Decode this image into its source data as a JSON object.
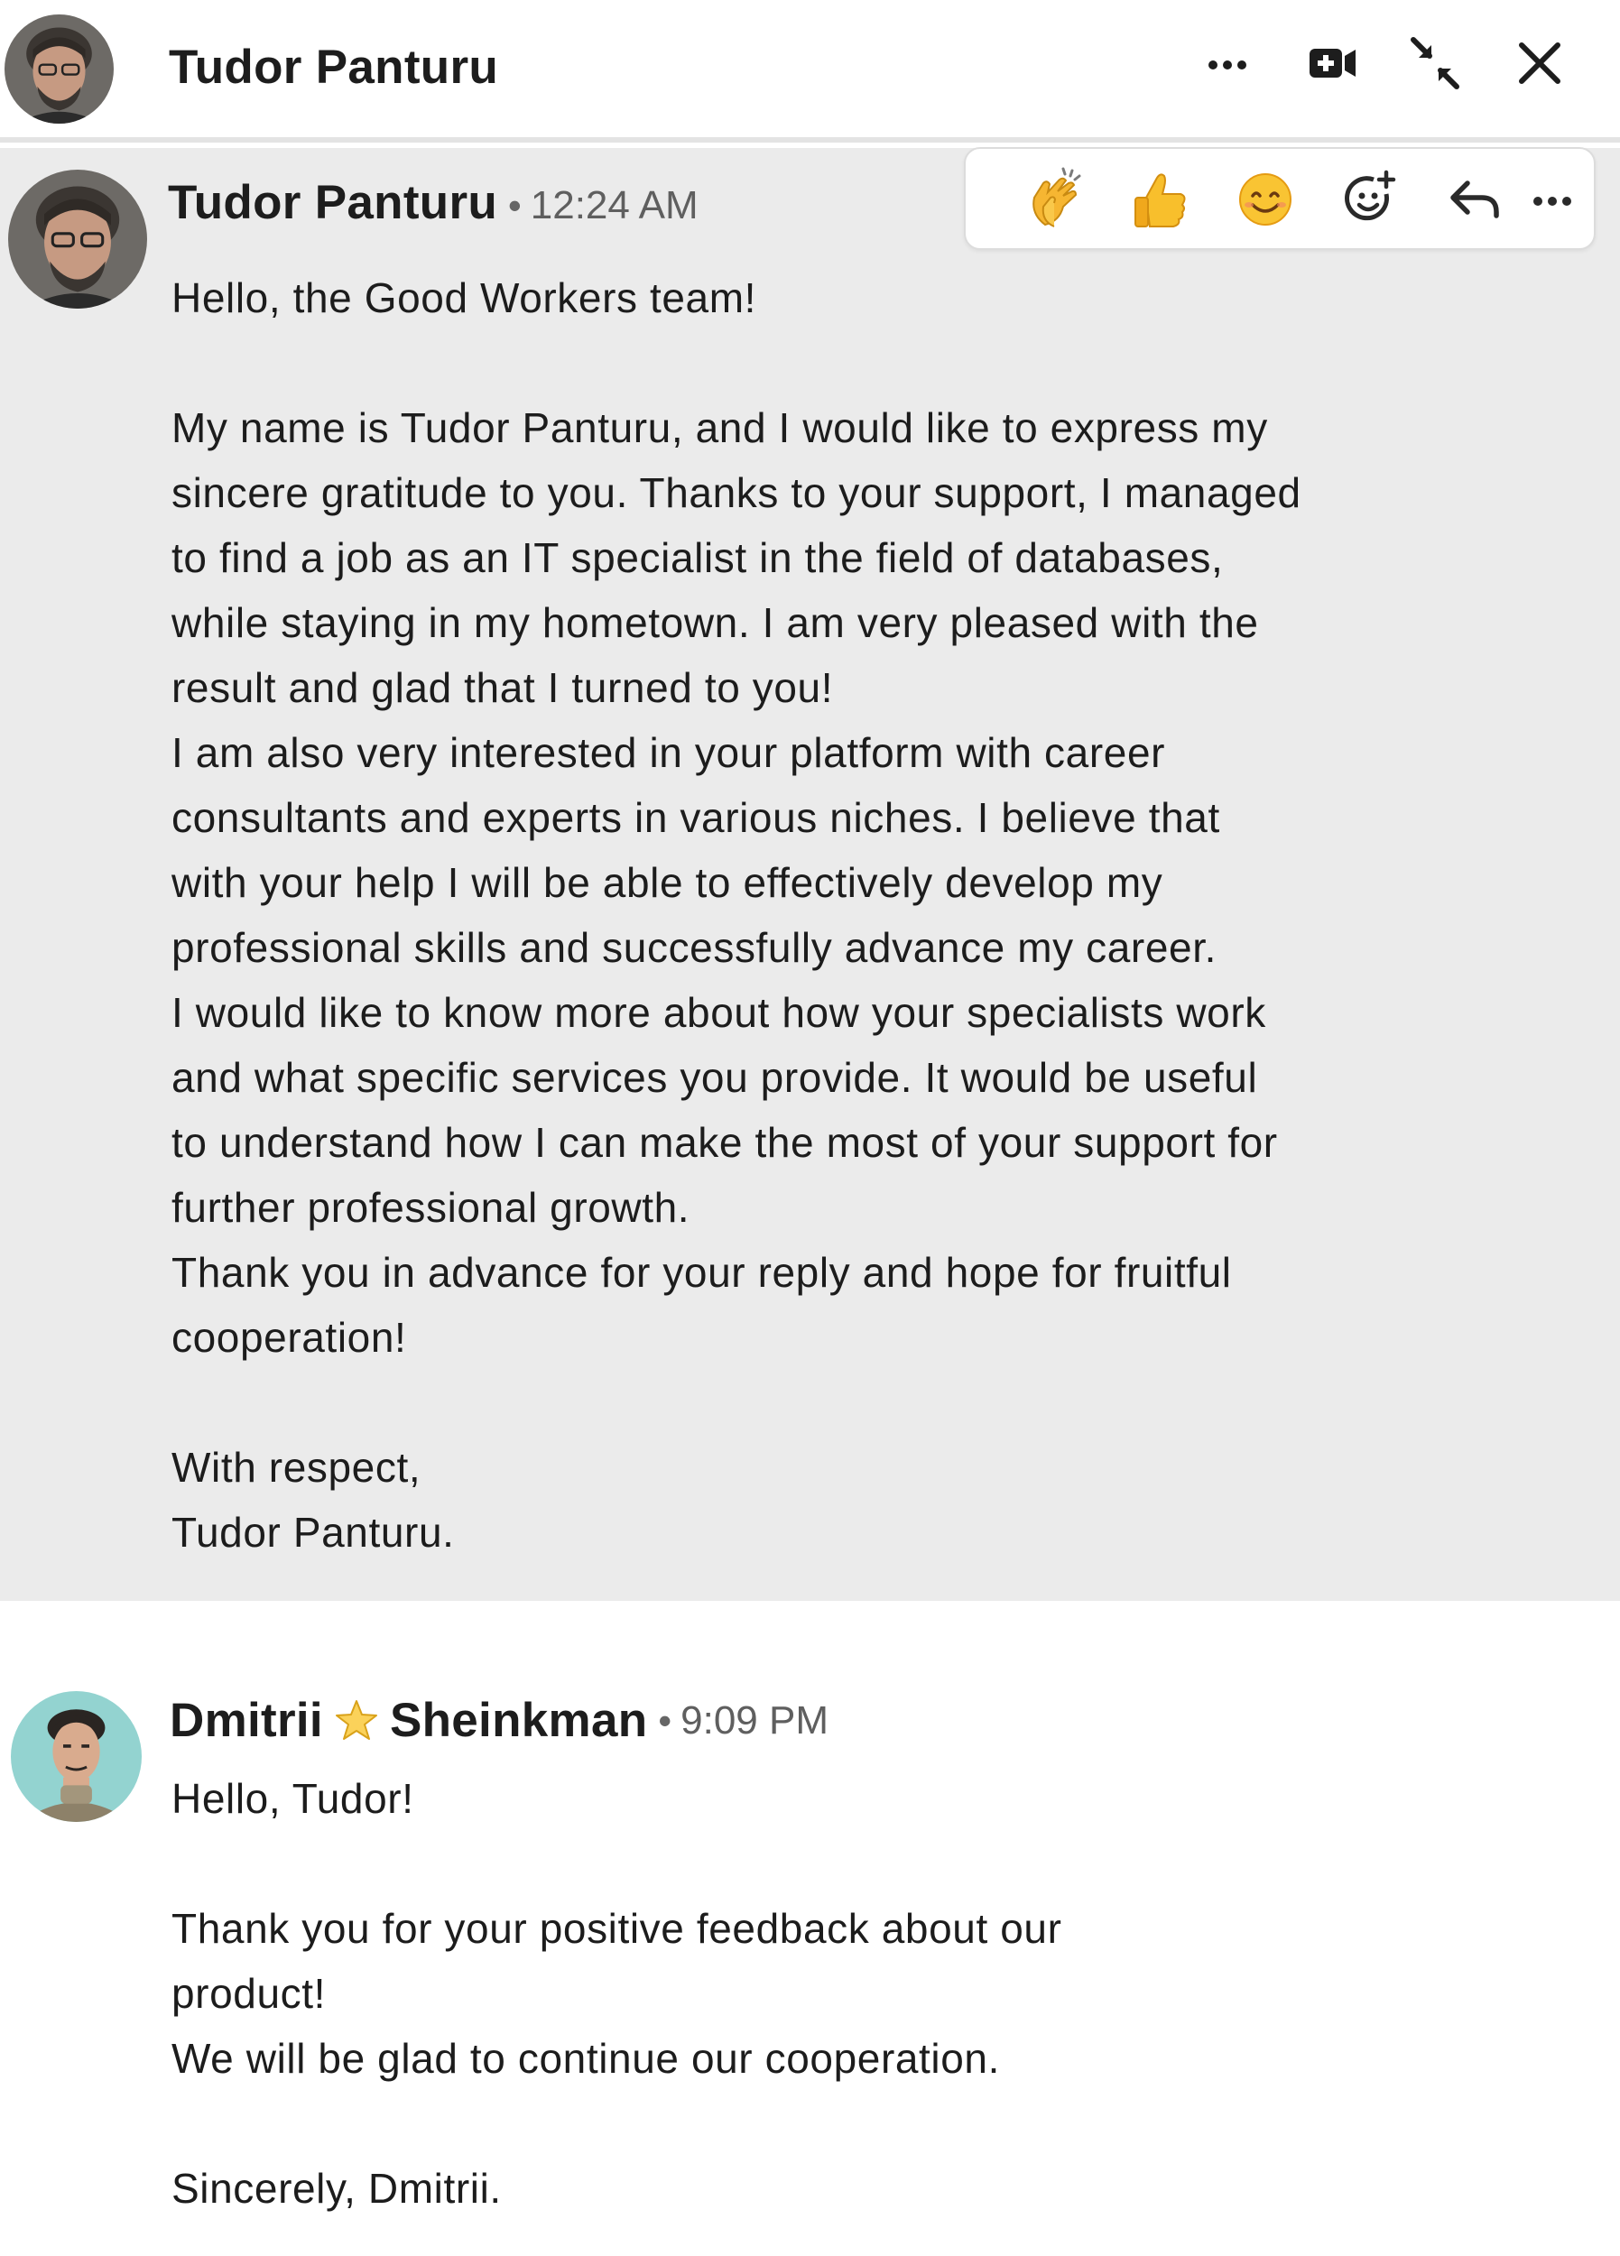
{
  "header": {
    "contact_name": "Tudor Panturu",
    "icons": [
      "more-icon",
      "video-call-icon",
      "minimize-icon",
      "close-icon"
    ]
  },
  "toolbar": {
    "icons": [
      "clapping-hands-icon",
      "thumbs-up-icon",
      "smiling-face-icon",
      "add-reaction-icon",
      "reply-icon",
      "more-icon"
    ]
  },
  "messages": [
    {
      "sender": "Tudor Panturu",
      "separator": "•",
      "time": "12:24 AM",
      "body": "Hello, the Good Workers team!\n\nMy name is Tudor Panturu, and I would like to express my\nsincere gratitude to you. Thanks to your support, I managed\nto find a job as an IT specialist in the field of databases,\nwhile staying in my hometown. I am very pleased with the\nresult and glad that I turned to you!\nI am also very interested in your platform with career\nconsultants and experts in various niches. I believe that\nwith your help I will be able to effectively develop my\nprofessional skills and successfully advance my career.\nI would like to know more about how your specialists work\nand what specific services you provide. It would be useful\nto understand how I can make the most of your support for\nfurther professional growth.\nThank you in advance for your reply and hope for fruitful\ncooperation!\n\nWith respect,\nTudor Panturu."
    },
    {
      "sender_first": "Dmitrii",
      "sender_last": "Sheinkman",
      "separator": "•",
      "time": "9:09 PM",
      "body": "Hello, Tudor!\n\nThank you for your positive feedback about our\nproduct!\nWe will be glad to continue our cooperation.\n\nSincerely, Dmitrii."
    }
  ],
  "colors": {
    "highlight_background": "#ebebeb",
    "text": "#1c1c1c",
    "timestamp": "#5f5f5f"
  }
}
